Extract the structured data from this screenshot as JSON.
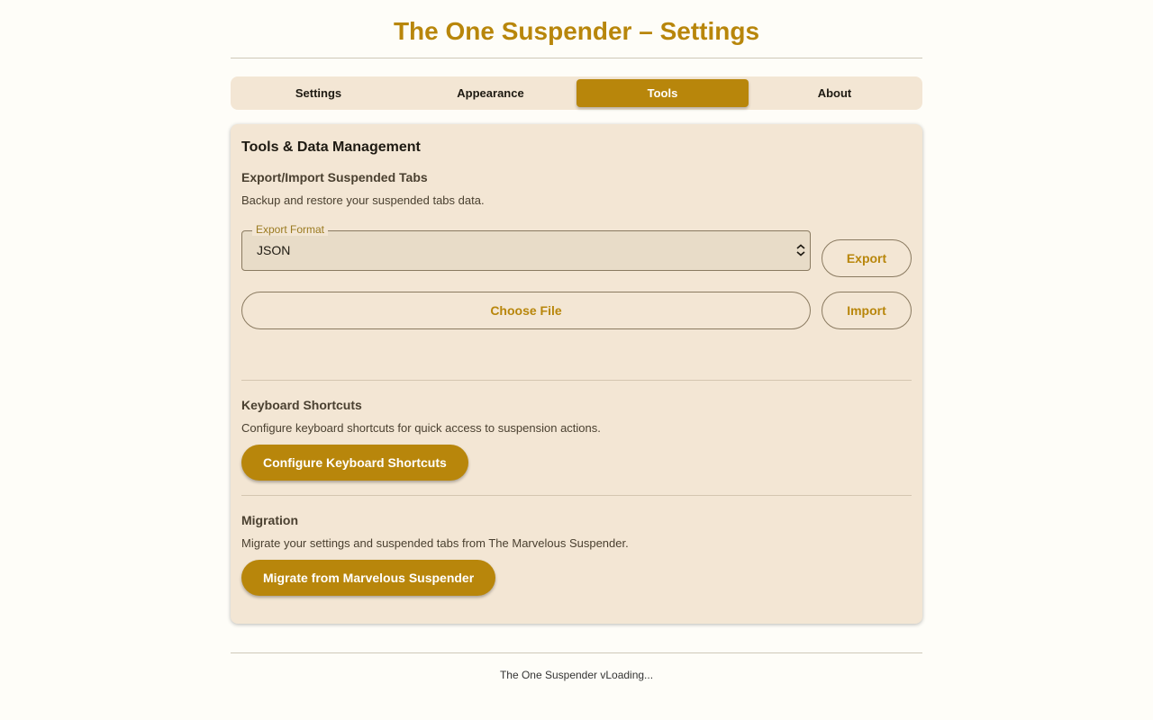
{
  "header": {
    "title": "The One Suspender – Settings"
  },
  "tabs": [
    {
      "label": "Settings",
      "active": false
    },
    {
      "label": "Appearance",
      "active": false
    },
    {
      "label": "Tools",
      "active": true
    },
    {
      "label": "About",
      "active": false
    }
  ],
  "card": {
    "title": "Tools & Data Management",
    "export_import": {
      "title": "Export/Import Suspended Tabs",
      "description": "Backup and restore your suspended tabs data.",
      "format_label": "Export Format",
      "format_value": "JSON",
      "export_label": "Export",
      "choose_file_label": "Choose File",
      "import_label": "Import"
    },
    "shortcuts": {
      "title": "Keyboard Shortcuts",
      "description": "Configure keyboard shortcuts for quick access to suspension actions.",
      "button_label": "Configure Keyboard Shortcuts"
    },
    "migration": {
      "title": "Migration",
      "description": "Migrate your settings and suspended tabs from The Marvelous Suspender.",
      "button_label": "Migrate from Marvelous Suspender"
    }
  },
  "footer": {
    "text": "The One Suspender vLoading..."
  },
  "colors": {
    "accent": "#b8860b",
    "background": "#fefdf8",
    "card": "#f3e6d4"
  },
  "icons": {
    "select": "chevron-updown-icon"
  }
}
